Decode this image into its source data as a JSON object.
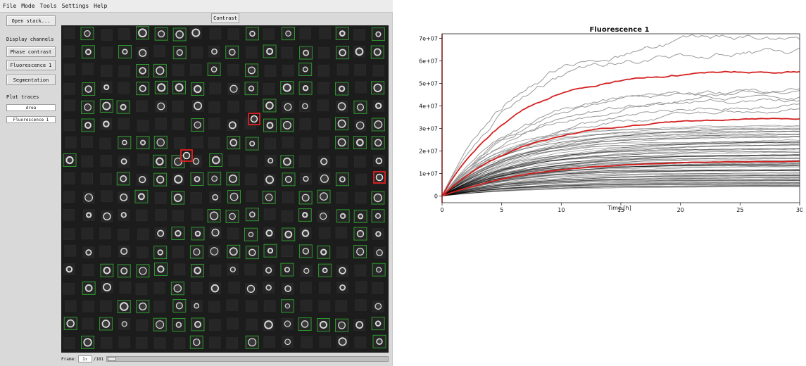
{
  "menu": [
    "File",
    "Mode",
    "Tools",
    "Settings",
    "Help"
  ],
  "sidebar": {
    "open_stack": "Open stack...",
    "display_channels_label": "Display channels",
    "channels": [
      "Phase contrast",
      "Fluorescence 1",
      "Segmentation"
    ],
    "plot_traces_label": "Plot traces",
    "traces": [
      "Area",
      "Fluorescence 1"
    ]
  },
  "viewer": {
    "contrast_label": "Contrast",
    "frame_label": "Frame:",
    "frame_value": "1",
    "frame_total": "/181",
    "box_color": "#2fa52f",
    "selected_color": "#e02020"
  },
  "chart_data": {
    "type": "line",
    "title": "Fluorescence 1",
    "xlabel": "Time [h]",
    "ylabel": "",
    "xlim": [
      0,
      30
    ],
    "ylim": [
      -3000000,
      72000000
    ],
    "xticks": [
      0,
      5,
      10,
      15,
      20,
      25,
      30
    ],
    "xtick_labels": [
      "0",
      "5",
      "10",
      "15",
      "20",
      "25",
      "30"
    ],
    "yticks": [
      0,
      10000000,
      20000000,
      30000000,
      40000000,
      50000000,
      60000000,
      70000000
    ],
    "ytick_labels": [
      "0",
      "1e+07",
      "2e+07",
      "3e+07",
      "4e+07",
      "5e+07",
      "6e+07",
      "7e+07"
    ],
    "vertical_marker_x": 0,
    "colors": {
      "highlight": "#d42020",
      "grey": "#9a9a9a",
      "dark": "#000000"
    },
    "highlighted_series": [
      {
        "plateau": 56000000,
        "rise_time": 6
      },
      {
        "plateau": 35000000,
        "rise_time": 7
      },
      {
        "plateau": 16000000,
        "rise_time": 8
      }
    ],
    "grey_series": [
      {
        "plateau": 70000000,
        "rise_time": 6
      },
      {
        "plateau": 64000000,
        "rise_time": 6
      },
      {
        "plateau": 48000000,
        "rise_time": 7
      },
      {
        "plateau": 47000000,
        "rise_time": 7
      },
      {
        "plateau": 45000000,
        "rise_time": 7
      },
      {
        "plateau": 43000000,
        "rise_time": 7
      },
      {
        "plateau": 41000000,
        "rise_time": 8
      },
      {
        "plateau": 39000000,
        "rise_time": 8
      }
    ],
    "bulk_series_count": 90,
    "bulk_plateau_range": [
      4000000,
      32000000
    ]
  }
}
